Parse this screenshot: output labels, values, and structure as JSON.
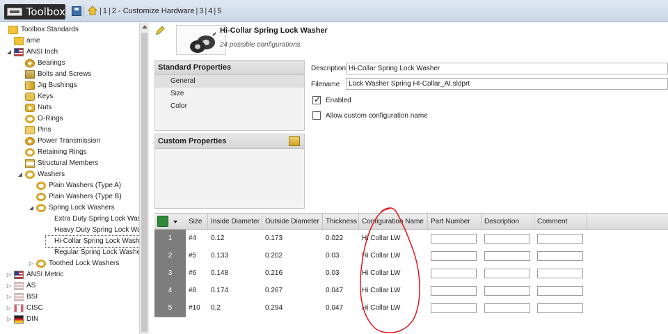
{
  "toolbar": {
    "app_title": "Toolbox",
    "steps": [
      "1",
      "2 - Customize Hardware",
      "3",
      "4",
      "5"
    ]
  },
  "tree": {
    "items": [
      {
        "label": "Toolbox Standards",
        "icon": "folder-icon",
        "expander": ""
      },
      {
        "label": "ame",
        "icon": "folder-icon",
        "expander": ""
      },
      {
        "label": "ANSI Inch",
        "icon": "flag-us-icon",
        "expander": "◢"
      },
      {
        "label": "Bearings",
        "icon": "bearing-icon",
        "expander": ""
      },
      {
        "label": "Bolts and Screws",
        "icon": "bolt-icon",
        "expander": ""
      },
      {
        "label": "Jig Bushings",
        "icon": "bushing-icon",
        "expander": ""
      },
      {
        "label": "Keys",
        "icon": "key-icon",
        "expander": ""
      },
      {
        "label": "Nuts",
        "icon": "nut-icon",
        "expander": ""
      },
      {
        "label": "O-Rings",
        "icon": "oring-icon",
        "expander": ""
      },
      {
        "label": "Pins",
        "icon": "pin-icon",
        "expander": ""
      },
      {
        "label": "Power Transmission",
        "icon": "gear-icon",
        "expander": ""
      },
      {
        "label": "Retaining Rings",
        "icon": "retaining-ring-icon",
        "expander": ""
      },
      {
        "label": "Structural Members",
        "icon": "beam-icon",
        "expander": ""
      },
      {
        "label": "Washers",
        "icon": "washer-icon",
        "expander": "◢"
      },
      {
        "label": "Plain Washers (Type A)",
        "icon": "washer-icon",
        "expander": ""
      },
      {
        "label": "Plain Washers (Type B)",
        "icon": "washer-icon",
        "expander": ""
      },
      {
        "label": "Spring Lock Washers",
        "icon": "washer-icon",
        "expander": "◢"
      },
      {
        "label": "Extra Duty Spring Lock Washe",
        "icon": "",
        "expander": ""
      },
      {
        "label": "Heavy Duty Spring Lock Wasl",
        "icon": "",
        "expander": ""
      },
      {
        "label": "Hi-Collar Spring Lock Washer",
        "icon": "",
        "expander": ""
      },
      {
        "label": "Regular Spring Lock Washer",
        "icon": "",
        "expander": ""
      },
      {
        "label": "Toothed Lock Washers",
        "icon": "washer-icon",
        "expander": "▷"
      },
      {
        "label": "ANSI Metric",
        "icon": "flag-us-icon",
        "expander": "▷"
      },
      {
        "label": "AS",
        "icon": "flag-grey-icon",
        "expander": "▷"
      },
      {
        "label": "BSI",
        "icon": "flag-grey-icon",
        "expander": "▷"
      },
      {
        "label": "CISC",
        "icon": "flag-ca-icon",
        "expander": "▷"
      },
      {
        "label": "DIN",
        "icon": "flag-de-icon",
        "expander": "▷"
      }
    ]
  },
  "part": {
    "title": "Hi-Collar Spring Lock Washer",
    "subtitle": "24 possible configurations"
  },
  "standard_properties": {
    "header": "Standard Properties",
    "items": [
      "General",
      "Size",
      "Color"
    ]
  },
  "custom_properties": {
    "header": "Custom Properties"
  },
  "form": {
    "description_label": "Description",
    "description_value": "Hi-Collar Spring Lock Washer",
    "filename_label": "Filename",
    "filename_value": "Lock Washer Spring HI-Collar_AI.sldprt",
    "enabled_label": "Enabled",
    "enabled_checked": true,
    "allow_custom_label": "Allow custom configuration name",
    "allow_custom_checked": false
  },
  "grid": {
    "columns": [
      "Size",
      "Inside Diameter",
      "Outside Diameter",
      "Thickness",
      "Configuration Name",
      "Part Number",
      "Description",
      "Comment"
    ],
    "rows": [
      {
        "n": "1",
        "size": "#4",
        "inside": "0.12",
        "outside": "0.173",
        "thickness": "0.022",
        "config": "Hi Collar LW"
      },
      {
        "n": "2",
        "size": "#5",
        "inside": "0.133",
        "outside": "0.202",
        "thickness": "0.03",
        "config": "Hi Collar LW"
      },
      {
        "n": "3",
        "size": "#6",
        "inside": "0.148",
        "outside": "0.216",
        "thickness": "0.03",
        "config": "Hi Collar LW"
      },
      {
        "n": "4",
        "size": "#8",
        "inside": "0.174",
        "outside": "0.267",
        "thickness": "0.047",
        "config": "Hi Collar LW"
      },
      {
        "n": "5",
        "size": "#10",
        "inside": "0.2",
        "outside": "0.294",
        "thickness": "0.047",
        "config": "Hi Collar LW"
      }
    ]
  },
  "colors": {
    "annotation": "#e0141a",
    "row_number_bg": "#7d7d7d",
    "toolbar_bg": "#cad6e6"
  }
}
